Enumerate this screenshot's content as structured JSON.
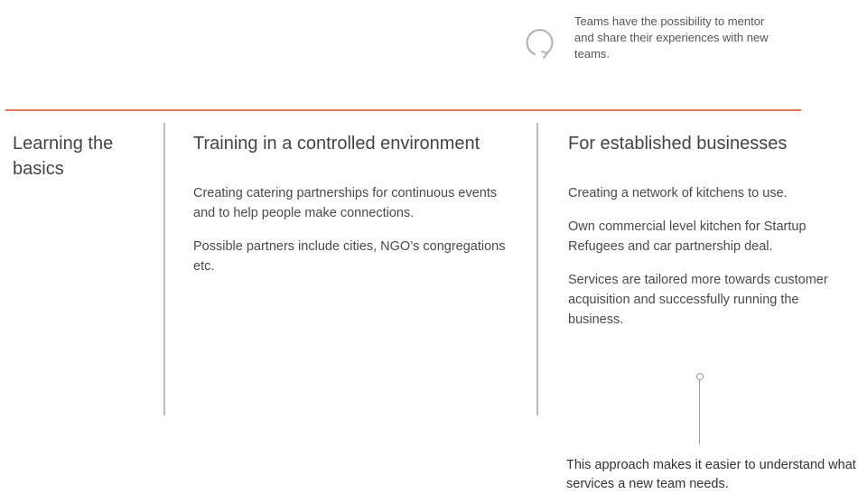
{
  "top_note": {
    "icon": "cycle-icon",
    "text": "Teams have the possibility to mentor and share their experiences with new teams."
  },
  "columns": [
    {
      "title": "Learning the basics",
      "paragraphs": []
    },
    {
      "title": "Training in a controlled environment",
      "paragraphs": [
        "Creating catering partnerships for continuous events and to help people make connections.",
        "Possible partners include cities, NGO’s congregations etc."
      ]
    },
    {
      "title": "For established businesses",
      "paragraphs": [
        "Creating a network of kitchens to use.",
        "Own commercial level kitchen for Startup Refugees and car partnership deal.",
        "Services are tailored more towards customer acquisition and successfully running the business."
      ]
    }
  ],
  "bottom_note": "This approach makes it easier to understand what services a new team needs.",
  "colors": {
    "accent_divider": "#e4795a",
    "column_divider": "#bdbdbd",
    "text": "#4a4a4a"
  }
}
